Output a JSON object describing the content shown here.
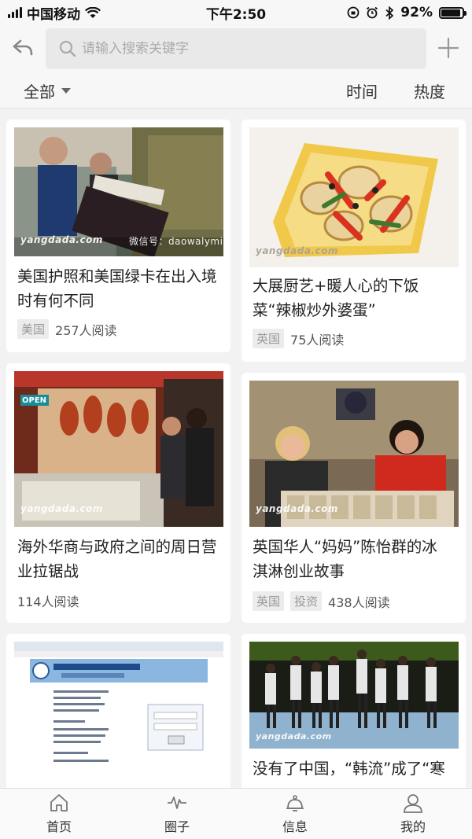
{
  "status_bar": {
    "carrier": "中国移动",
    "time": "下午2:50",
    "battery": "92%",
    "battery_level": 0.92
  },
  "search": {
    "placeholder": "请输入搜索关键字"
  },
  "filters": {
    "all_label": "全部",
    "time_label": "时间",
    "hot_label": "热度"
  },
  "articles": [
    {
      "title": "美国护照和美国绿卡在出入境时有何不同",
      "tags": [
        "美国"
      ],
      "reads": "257人阅读",
      "image_watermark": "yangdada.com",
      "image_caption": "微信号：daowalymin"
    },
    {
      "title": "大展厨艺+暖人心的下饭菜“辣椒炒外婆蛋”",
      "tags": [
        "英国"
      ],
      "reads": "75人阅读",
      "image_watermark": "yangdada.com"
    },
    {
      "title": "海外华商与政府之间的周日营业拉锯战",
      "tags": [],
      "reads": "114人阅读",
      "image_watermark": "yangdada.com",
      "image_sign": "OPEN"
    },
    {
      "title": "英国华人“妈妈”陈怡群的冰淇淋创业故事",
      "tags": [
        "英国",
        "投资"
      ],
      "reads": "438人阅读",
      "image_watermark": "yangdada.com"
    },
    {
      "title": "",
      "tags": [],
      "reads": "",
      "image_watermark": ""
    },
    {
      "title": "没有了中国，“韩流”成了“寒",
      "tags": [],
      "reads": "",
      "image_watermark": "yangdada.com"
    }
  ],
  "bottom_nav": [
    {
      "label": "首页",
      "icon": "home-icon"
    },
    {
      "label": "圈子",
      "icon": "pulse-icon"
    },
    {
      "label": "信息",
      "icon": "bell-icon"
    },
    {
      "label": "我的",
      "icon": "user-icon"
    }
  ]
}
